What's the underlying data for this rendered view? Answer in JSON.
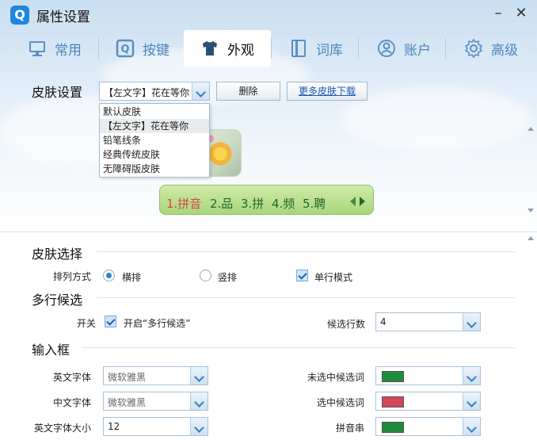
{
  "window": {
    "title": "属性设置",
    "app_icon_letter": "Q"
  },
  "tabs": [
    {
      "label": "常用",
      "icon": "monitor-icon"
    },
    {
      "label": "按键",
      "icon": "key-icon"
    },
    {
      "label": "外观",
      "icon": "shirt-icon",
      "active": true
    },
    {
      "label": "词库",
      "icon": "book-icon"
    },
    {
      "label": "账户",
      "icon": "user-icon"
    },
    {
      "label": "高级",
      "icon": "gear-icon"
    }
  ],
  "skin": {
    "label": "皮肤设置",
    "selected": "【左文字】花在等你",
    "delete_label": "删除",
    "more_label": "更多皮肤下载",
    "options": [
      "默认皮肤",
      "【左文字】花在等你",
      "铅笔线条",
      "经典传统皮肤",
      "无障碍版皮肤"
    ]
  },
  "preview": {
    "candidates": [
      "1.拼音",
      "2.品",
      "3.拼",
      "4.频",
      "5.聘"
    ]
  },
  "skin_select": {
    "title": "皮肤选择",
    "layout_label": "排列方式",
    "horizontal_label": "横排",
    "vertical_label": "竖排",
    "single_line_label": "单行模式",
    "layout_value": "横排",
    "single_line_checked": true
  },
  "multi_line": {
    "title": "多行候选",
    "switch_label": "开关",
    "enable_label": "开启“多行候选”",
    "enabled": true,
    "rows_label": "候选行数",
    "rows_value": "4"
  },
  "input_box": {
    "title": "输入框",
    "en_font_label": "英文字体",
    "en_font_value": "微软雅黑",
    "cn_font_label": "中文字体",
    "cn_font_value": "微软雅黑",
    "en_size_label": "英文字体大小",
    "en_size_value": "12",
    "unselected_label": "未选中候选词",
    "unselected_color": "#1e8a3c",
    "selected_label": "选中候选词",
    "selected_color": "#d2465a",
    "pinyin_label": "拼音串",
    "pinyin_color": "#1e8a3c"
  }
}
